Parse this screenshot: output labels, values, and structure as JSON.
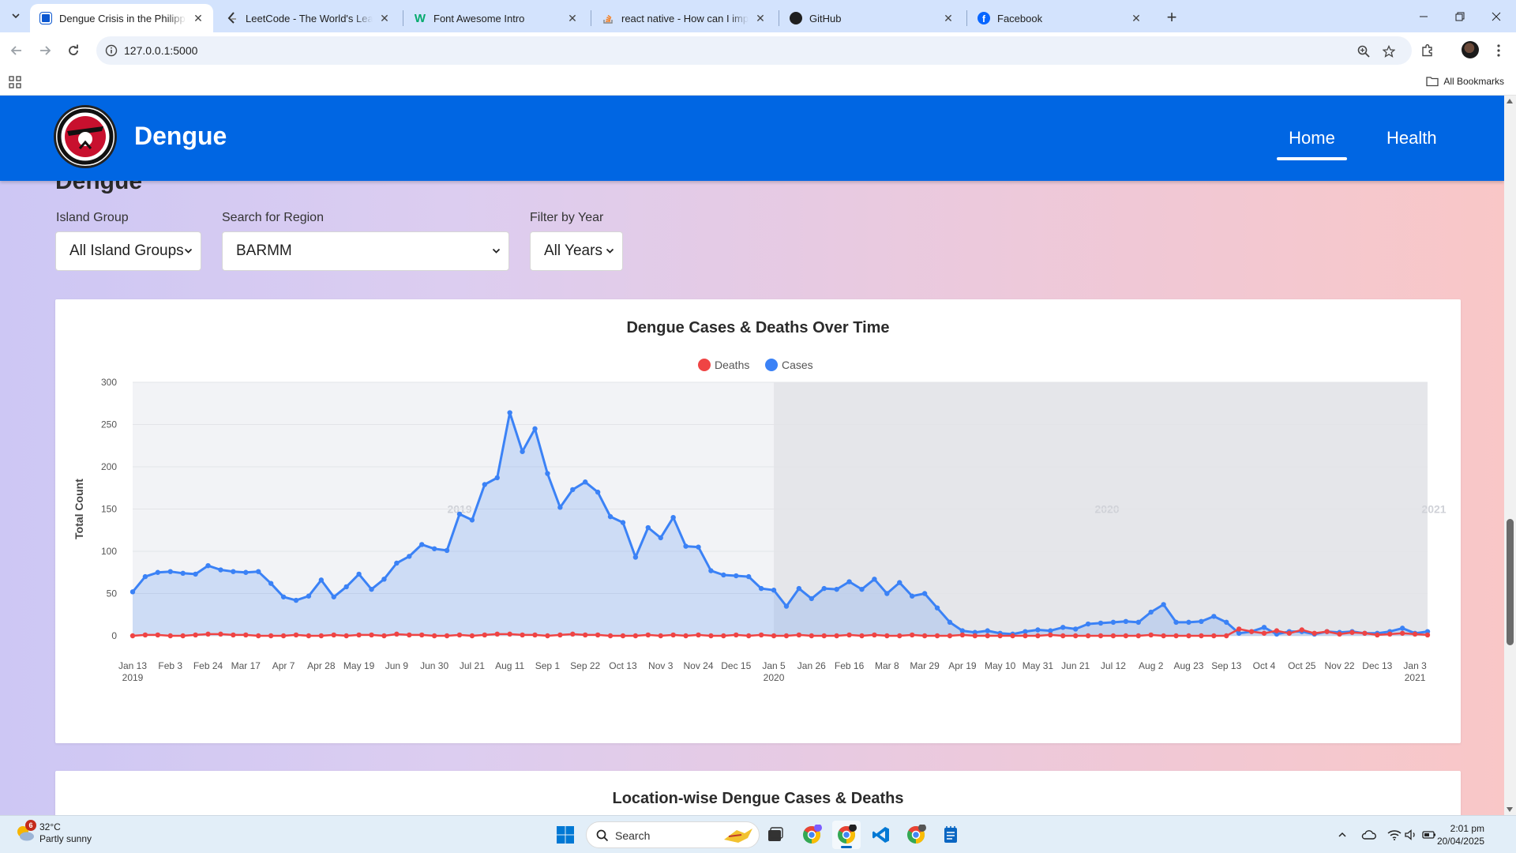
{
  "browser": {
    "tabs": [
      {
        "title": "Dengue Crisis in the Philippines",
        "active": true,
        "icon": "dengue-favicon"
      },
      {
        "title": "LeetCode - The World's Leading Online Programming Learning Platform",
        "active": false,
        "icon": "leetcode-icon"
      },
      {
        "title": "Font Awesome Intro",
        "active": false,
        "icon": "w3schools-icon"
      },
      {
        "title": "react native - How can I implement",
        "active": false,
        "icon": "stackoverflow-icon"
      },
      {
        "title": "GitHub",
        "active": false,
        "icon": "github-icon"
      },
      {
        "title": "Facebook",
        "active": false,
        "icon": "facebook-icon"
      }
    ],
    "url": "127.0.0.1:5000",
    "bookmarks_label": "All Bookmarks"
  },
  "site": {
    "brand": "Dengue",
    "nav": [
      "Home",
      "Health"
    ],
    "active_nav": "Home",
    "clipped_heading": "Dengue"
  },
  "filters": [
    {
      "label": "Island Group",
      "selected": "All Island Groups"
    },
    {
      "label": "Search for Region",
      "selected": "BARMM"
    },
    {
      "label": "Filter by Year",
      "selected": "All Years"
    }
  ],
  "chart_card": {
    "title": "Dengue Cases & Deaths Over Time"
  },
  "second_card": {
    "title": "Location-wise Dengue Cases & Deaths"
  },
  "colors": {
    "header": "#0066e3",
    "cases": "#3b82f6",
    "deaths": "#ef4444"
  },
  "chart_data": {
    "type": "line",
    "title": "Dengue Cases & Deaths Over Time",
    "ylabel": "Total Count",
    "xlabel": "",
    "ylim": [
      0,
      300
    ],
    "yticks": [
      0,
      50,
      100,
      150,
      200,
      250,
      300
    ],
    "legend": [
      "Deaths",
      "Cases"
    ],
    "legend_position": "top-center",
    "grid": true,
    "year_bands": [
      {
        "label": "2019",
        "start_week": 0,
        "end_week": 51
      },
      {
        "label": "2020",
        "start_week": 51,
        "end_week": 103
      },
      {
        "label": "2021",
        "start_week": 103,
        "end_week": 104
      }
    ],
    "x_ticks": [
      {
        "week": 0,
        "label": "Jan 13",
        "sub": "2019"
      },
      {
        "week": 3,
        "label": "Feb 3"
      },
      {
        "week": 6,
        "label": "Feb 24"
      },
      {
        "week": 9,
        "label": "Mar 17"
      },
      {
        "week": 12,
        "label": "Apr 7"
      },
      {
        "week": 15,
        "label": "Apr 28"
      },
      {
        "week": 18,
        "label": "May 19"
      },
      {
        "week": 21,
        "label": "Jun 9"
      },
      {
        "week": 24,
        "label": "Jun 30"
      },
      {
        "week": 27,
        "label": "Jul 21"
      },
      {
        "week": 30,
        "label": "Aug 11"
      },
      {
        "week": 33,
        "label": "Sep 1"
      },
      {
        "week": 36,
        "label": "Sep 22"
      },
      {
        "week": 39,
        "label": "Oct 13"
      },
      {
        "week": 42,
        "label": "Nov 3"
      },
      {
        "week": 45,
        "label": "Nov 24"
      },
      {
        "week": 48,
        "label": "Dec 15"
      },
      {
        "week": 51,
        "label": "Jan 5",
        "sub": "2020"
      },
      {
        "week": 54,
        "label": "Jan 26"
      },
      {
        "week": 57,
        "label": "Feb 16"
      },
      {
        "week": 60,
        "label": "Mar 8"
      },
      {
        "week": 63,
        "label": "Mar 29"
      },
      {
        "week": 66,
        "label": "Apr 19"
      },
      {
        "week": 69,
        "label": "May 10"
      },
      {
        "week": 72,
        "label": "May 31"
      },
      {
        "week": 75,
        "label": "Jun 21"
      },
      {
        "week": 78,
        "label": "Jul 12"
      },
      {
        "week": 81,
        "label": "Aug 2"
      },
      {
        "week": 84,
        "label": "Aug 23"
      },
      {
        "week": 87,
        "label": "Sep 13"
      },
      {
        "week": 90,
        "label": "Oct 4"
      },
      {
        "week": 93,
        "label": "Oct 25"
      },
      {
        "week": 96,
        "label": "Nov 22"
      },
      {
        "week": 99,
        "label": "Dec 13"
      },
      {
        "week": 102,
        "label": "Jan 3",
        "sub": "2021"
      }
    ],
    "series": [
      {
        "name": "Cases",
        "values": [
          52,
          70,
          75,
          76,
          74,
          73,
          83,
          78,
          76,
          75,
          76,
          62,
          46,
          42,
          47,
          66,
          46,
          58,
          73,
          55,
          67,
          86,
          94,
          108,
          103,
          101,
          144,
          137,
          179,
          187,
          264,
          218,
          245,
          192,
          152,
          173,
          182,
          170,
          141,
          134,
          93,
          128,
          116,
          140,
          106,
          105,
          77,
          72,
          71,
          70,
          56,
          54,
          35,
          56,
          44,
          56,
          55,
          64,
          55,
          67,
          50,
          63,
          47,
          50,
          33,
          16,
          6,
          4,
          6,
          3,
          2,
          5,
          7,
          6,
          10,
          8,
          14,
          15,
          16,
          17,
          16,
          28,
          37,
          16,
          16,
          17,
          23,
          16,
          3,
          5,
          10,
          2,
          5,
          5,
          2,
          5,
          4,
          5,
          3,
          3,
          5,
          9,
          3,
          5
        ],
        "color": "#3b82f6"
      },
      {
        "name": "Deaths",
        "values": [
          0,
          1,
          1,
          0,
          0,
          1,
          2,
          2,
          1,
          1,
          0,
          0,
          0,
          1,
          0,
          0,
          1,
          0,
          1,
          1,
          0,
          2,
          1,
          1,
          0,
          0,
          1,
          0,
          1,
          2,
          2,
          1,
          1,
          0,
          1,
          2,
          1,
          1,
          0,
          0,
          0,
          1,
          0,
          1,
          0,
          1,
          0,
          0,
          1,
          0,
          1,
          0,
          0,
          1,
          0,
          0,
          0,
          1,
          0,
          1,
          0,
          0,
          1,
          0,
          0,
          0,
          1,
          0,
          0,
          0,
          0,
          0,
          0,
          1,
          0,
          0,
          0,
          0,
          0,
          0,
          0,
          1,
          0,
          0,
          0,
          0,
          0,
          0,
          8,
          5,
          3,
          6,
          3,
          7,
          3,
          5,
          2,
          4,
          3,
          1,
          2,
          3,
          2,
          1
        ],
        "color": "#ef4444"
      }
    ]
  },
  "taskbar": {
    "weather_temp": "32°C",
    "weather_desc": "Partly sunny",
    "weather_badge": "6",
    "search_label": "Search",
    "time": "2:01 pm",
    "date": "20/04/2025"
  }
}
